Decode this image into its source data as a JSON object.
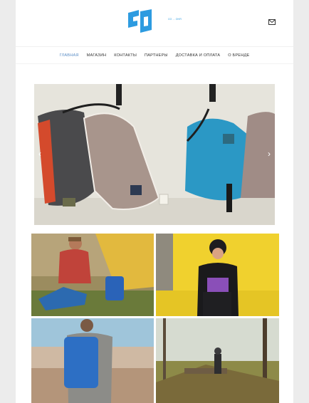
{
  "brand": {
    "logo_text": "ГО",
    "tagline": "СО ... ОНЯ"
  },
  "nav": {
    "items": [
      {
        "label": "ГЛАВНАЯ",
        "active": true
      },
      {
        "label": "МАГАЗИН",
        "active": false
      },
      {
        "label": "КОНТАКТЫ",
        "active": false
      },
      {
        "label": "ПАРТНЕРЫ",
        "active": false
      },
      {
        "label": "ДОСТАВКА И ОПЛАТА",
        "active": false
      },
      {
        "label": "О БРЕНДЕ",
        "active": false
      }
    ]
  },
  "slider": {
    "prev_icon": "chevron-left-icon",
    "next_icon": "chevron-right-icon",
    "prev_glyph": "‹",
    "next_glyph": "›"
  },
  "header": {
    "mail_icon": "mail-icon"
  },
  "colors": {
    "accent": "#2d9be0",
    "nav_active": "#5b8ec6"
  }
}
